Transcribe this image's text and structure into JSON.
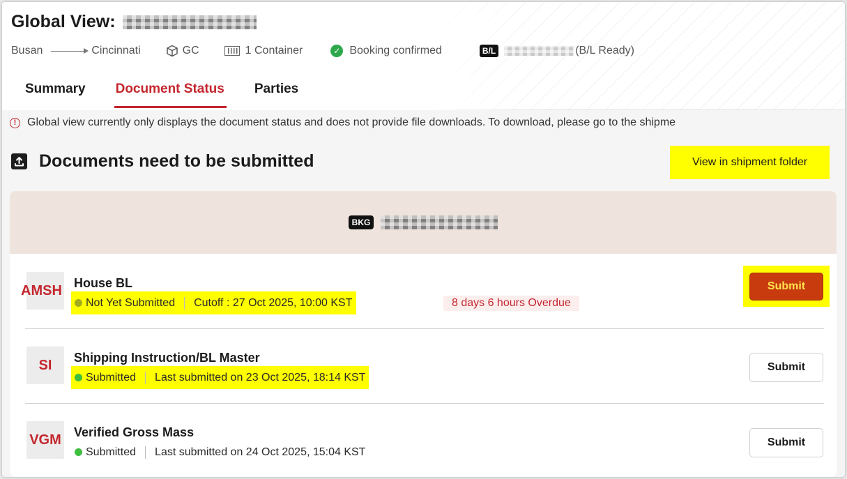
{
  "header": {
    "title": "Global View:",
    "route": {
      "origin": "Busan",
      "destination": "Cincinnati"
    },
    "cargo_type": "GC",
    "containers": "1 Container",
    "booking_status": "Booking confirmed",
    "bl_tag": "B/L",
    "bl_status": "(B/L Ready)"
  },
  "tabs": [
    {
      "label": "Summary",
      "active": false
    },
    {
      "label": "Document Status",
      "active": true
    },
    {
      "label": "Parties",
      "active": false
    }
  ],
  "notice": "Global view currently only displays the document status and does not provide file downloads. To download, please go to the shipme",
  "section": {
    "title": "Documents need to be submitted",
    "folder_link": "View in shipment folder"
  },
  "booking": {
    "tag": "BKG"
  },
  "documents": [
    {
      "code": "AMSH",
      "name": "House BL",
      "status": "Not Yet Submitted",
      "detail": "Cutoff : 27 Oct 2025, 10:00 KST",
      "overdue": "8 days 6 hours Overdue",
      "button": "Submit"
    },
    {
      "code": "SI",
      "name": "Shipping Instruction/BL Master",
      "status": "Submitted",
      "detail": "Last submitted on 23 Oct 2025, 18:14 KST",
      "button": "Submit"
    },
    {
      "code": "VGM",
      "name": "Verified Gross Mass",
      "status": "Submitted",
      "detail": "Last submitted on 24 Oct 2025, 15:04 KST",
      "button": "Submit"
    }
  ],
  "colors": {
    "accent": "#c4262e",
    "submit_button": "#c83b0f",
    "highlight": "#ffff00",
    "status_pending": "#a3ad1c",
    "status_done": "#3fbf3f",
    "booking_confirmed": "#2ea84c"
  },
  "icons": {
    "route_arrow": "arrow-right-icon",
    "cargo": "cube-icon",
    "container": "container-icon",
    "booking": "check-circle-icon",
    "notice": "alert-circle-icon",
    "section": "upload-icon"
  }
}
